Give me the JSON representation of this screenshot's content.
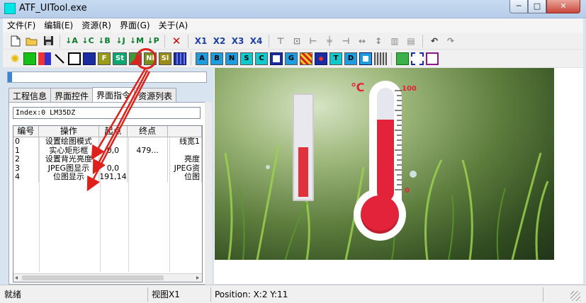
{
  "window": {
    "title": "ATF_UITool.exe",
    "min_glyph": "─",
    "max_glyph": "□",
    "close_glyph": "✕"
  },
  "menu": [
    "文件(F)",
    "编辑(E)",
    "资源(R)",
    "界面(G)",
    "关于(A)"
  ],
  "toolbar1": {
    "move_a": "A",
    "move_c": "C",
    "move_b": "B",
    "move_j": "J",
    "move_m": "M",
    "move_p": "P",
    "delete_glyph": "✕",
    "x1": "X1",
    "x2": "X2",
    "x3": "X3",
    "x4": "X4"
  },
  "toolbar2": {
    "f": "F",
    "st": "St",
    "nl": "Nl",
    "sl": "Sl",
    "a": "A",
    "b": "B",
    "n": "N",
    "s": "S",
    "c": "C",
    "g": "G",
    "t": "T",
    "d": "D"
  },
  "progress": {
    "value": 0.02
  },
  "tabs": [
    "工程信息",
    "界面控件",
    "界面指令",
    "资源列表"
  ],
  "active_tab": 2,
  "index_field": "Index:0 LM35DZ",
  "table": {
    "columns": [
      "编号",
      "操作",
      "起点",
      "终点",
      ""
    ],
    "rows": [
      [
        "0",
        "设置绘图模式",
        "",
        "",
        "线宽1"
      ],
      [
        "1",
        "实心矩形框",
        "0,0",
        "479...",
        ""
      ],
      [
        "2",
        "设置背光亮度",
        "",
        "",
        "亮度"
      ],
      [
        "3",
        "JPEG图显示",
        "0,0",
        "",
        "JPEG资"
      ],
      [
        "4",
        "位图显示",
        "191,14",
        "",
        "位图"
      ]
    ]
  },
  "canvas": {
    "unit": "℃",
    "scale_max": "100",
    "scale_min": "0",
    "bar_level": 0.53,
    "thermometer_level": 0.72
  },
  "status": {
    "ready": "就绪",
    "view": "视图X1",
    "position": "Position: X:2 Y:11"
  },
  "colors": {
    "annotation_red": "#e0201a",
    "thermo_red": "#e2233a",
    "bar_red": "#e0323c"
  }
}
